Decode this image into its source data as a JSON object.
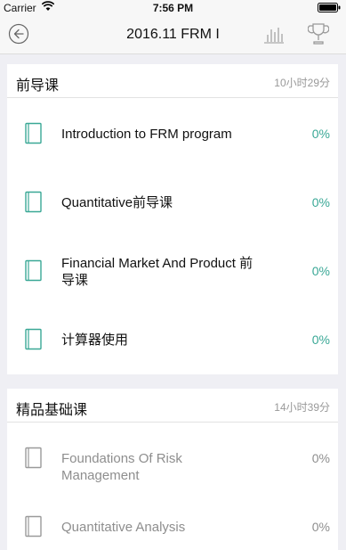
{
  "status_bar": {
    "carrier": "Carrier",
    "time": "7:56 PM"
  },
  "nav": {
    "title": "2016.11 FRM I",
    "icons": [
      "back-icon",
      "bar-chart-icon",
      "trophy-icon"
    ]
  },
  "colors": {
    "accent": "#3aa896",
    "muted": "#8e8e8e",
    "background": "#efeff4"
  },
  "sections": [
    {
      "title": "前导课",
      "duration": "10小时29分",
      "items": [
        {
          "title": "Introduction to FRM program",
          "progress": "0%"
        },
        {
          "title": "Quantitative前导课",
          "progress": "0%"
        },
        {
          "title": "Financial Market And Product 前导课",
          "progress": "0%"
        },
        {
          "title": "计算器使用",
          "progress": "0%"
        }
      ]
    },
    {
      "title": "精品基础课",
      "duration": "14小时39分",
      "items": [
        {
          "title": "Foundations Of Risk Management",
          "progress": "0%"
        },
        {
          "title": "Quantitative Analysis",
          "progress": "0%"
        }
      ]
    }
  ]
}
